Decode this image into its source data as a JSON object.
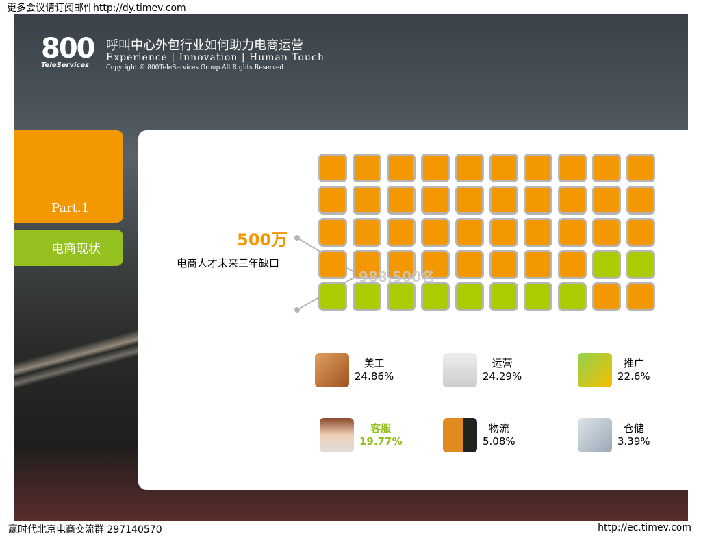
{
  "top_text": "更多会议请订阅邮件http://dy.timev.com",
  "header": {
    "logo_num": "800",
    "logo_sub": "TeleServices",
    "title": "呼叫中心外包行业如何助力电商运营",
    "tagline": "Experience | Innovation | Human Touch",
    "copyright": "Copyright © 800TeleServices Group.All Rights Reserved"
  },
  "tabs": {
    "part": "Part.1",
    "section": "电商现状"
  },
  "main": {
    "big_number": "500万",
    "gap_label": "电商人才未来三年缺口",
    "count": "988,500名",
    "grid": {
      "total": 50,
      "orange": 40,
      "green": 10
    },
    "items": [
      {
        "name": "美工",
        "pct": "24.86%",
        "icon": "palette-icon",
        "highlight": false
      },
      {
        "name": "运营",
        "pct": "24.29%",
        "icon": "gantt-chart-icon",
        "highlight": false
      },
      {
        "name": "推广",
        "pct": "22.6%",
        "icon": "envelope-icon",
        "highlight": false
      },
      {
        "name": "客服",
        "pct": "19.77%",
        "icon": "headset-agent-icon",
        "highlight": true
      },
      {
        "name": "物流",
        "pct": "5.08%",
        "icon": "truck-icon",
        "highlight": false
      },
      {
        "name": "仓储",
        "pct": "3.39%",
        "icon": "warehouse-icon",
        "highlight": false
      }
    ]
  },
  "colors": {
    "orange": "#f39800",
    "green": "#94c11f",
    "cell_green": "#aacc00"
  },
  "footer": {
    "left": "赢时代北京电商交流群 297140570",
    "right": "http://ec.timev.com"
  }
}
